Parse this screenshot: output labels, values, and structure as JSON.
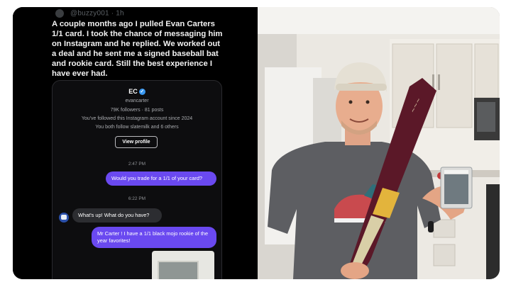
{
  "tweet": {
    "handle": "@buzzy001 · 1h",
    "text": "A couple months ago I pulled Evan Carters 1/1 card. I took the chance of messaging him on Instagram and he replied. We worked out a deal and he sent me a signed baseball bat and rookie card. Still the best experience I have ever had."
  },
  "dm": {
    "name": "EC",
    "username": "evancarter",
    "stats": "79K followers · 81 posts",
    "followed_since": "You've followed this Instagram account since 2024",
    "mutuals": "You both follow slatemilk and 6 others",
    "view_profile": "View profile",
    "time_1": "2:47 PM",
    "msg_1": "Would you trade for a 1/1 of your card?",
    "time_2": "6:22 PM",
    "reply": "What's up! What do you have?",
    "msg_2": "Mr Carter ! I have a 1/1 black mojo rookie of the year favorites!"
  },
  "colors": {
    "accent_purple": "#6a49f0",
    "bubble_gray": "#2c2d31",
    "verified_blue": "#3897f0",
    "bat_maroon": "#5b1828"
  }
}
